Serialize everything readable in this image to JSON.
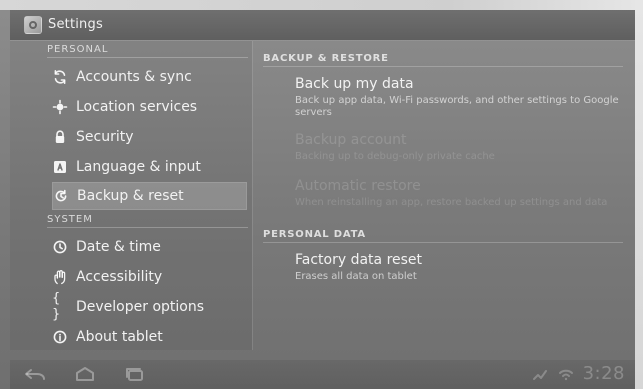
{
  "window": {
    "title": "Settings",
    "icon": "settings-icon"
  },
  "left_nav": {
    "sections": [
      {
        "header": "PERSONAL",
        "items": [
          {
            "label": "Accounts & sync",
            "icon": "sync-icon",
            "selected": false
          },
          {
            "label": "Location services",
            "icon": "location-icon",
            "selected": false
          },
          {
            "label": "Security",
            "icon": "lock-icon",
            "selected": false
          },
          {
            "label": "Language & input",
            "icon": "keyboard-icon",
            "selected": false
          },
          {
            "label": "Backup & reset",
            "icon": "backup-icon",
            "selected": true
          }
        ]
      },
      {
        "header": "SYSTEM",
        "items": [
          {
            "label": "Date & time",
            "icon": "clock-icon",
            "selected": false
          },
          {
            "label": "Accessibility",
            "icon": "hand-icon",
            "selected": false
          },
          {
            "label": "Developer options",
            "icon": "braces-icon",
            "selected": false
          },
          {
            "label": "About tablet",
            "icon": "info-icon",
            "selected": false
          }
        ]
      }
    ]
  },
  "right_pane": {
    "sections": [
      {
        "header": "BACKUP & RESTORE",
        "items": [
          {
            "title": "Back up my data",
            "subtitle": "Back up app data, Wi-Fi passwords, and other settings to Google servers",
            "enabled": true
          },
          {
            "title": "Backup account",
            "subtitle": "Backing up to debug-only private cache",
            "enabled": false
          },
          {
            "title": "Automatic restore",
            "subtitle": "When reinstalling an app, restore backed up settings and data",
            "enabled": false
          }
        ]
      },
      {
        "header": "PERSONAL DATA",
        "items": [
          {
            "title": "Factory data reset",
            "subtitle": "Erases all data on tablet",
            "enabled": true
          }
        ]
      }
    ]
  },
  "system_bar": {
    "time": "3:28",
    "buttons": [
      "back-icon",
      "home-icon",
      "recent-apps-icon"
    ]
  }
}
